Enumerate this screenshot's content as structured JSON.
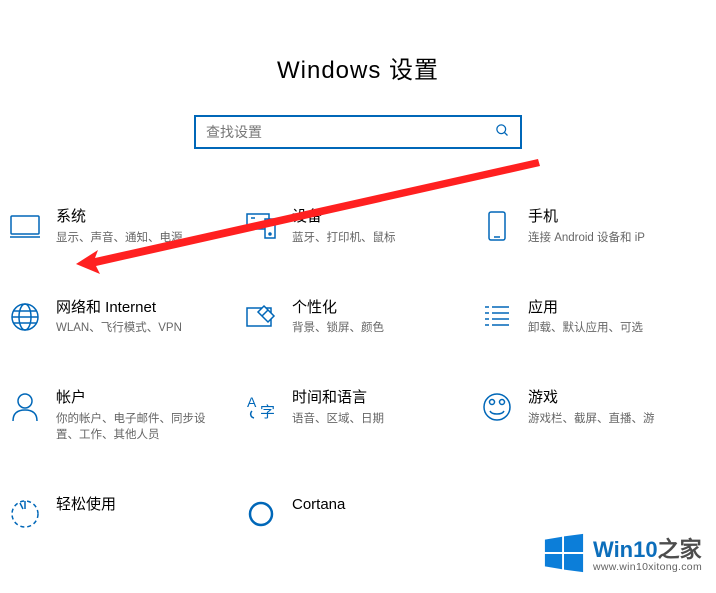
{
  "title": "Windows 设置",
  "search": {
    "placeholder": "查找设置"
  },
  "categories": [
    {
      "id": "system",
      "title": "系统",
      "desc": "显示、声音、通知、电源"
    },
    {
      "id": "devices",
      "title": "设备",
      "desc": "蓝牙、打印机、鼠标"
    },
    {
      "id": "phone",
      "title": "手机",
      "desc": "连接 Android 设备和 iP"
    },
    {
      "id": "network",
      "title": "网络和 Internet",
      "desc": "WLAN、飞行模式、VPN"
    },
    {
      "id": "personal",
      "title": "个性化",
      "desc": "背景、锁屏、颜色"
    },
    {
      "id": "apps",
      "title": "应用",
      "desc": "卸载、默认应用、可选"
    },
    {
      "id": "accounts",
      "title": "帐户",
      "desc": "你的帐户、电子邮件、同步设置、工作、其他人员"
    },
    {
      "id": "time",
      "title": "时间和语言",
      "desc": "语音、区域、日期"
    },
    {
      "id": "gaming",
      "title": "游戏",
      "desc": "游戏栏、截屏、直播、游"
    },
    {
      "id": "ease",
      "title": "轻松使用",
      "desc": ""
    },
    {
      "id": "cortana",
      "title": "Cortana",
      "desc": ""
    }
  ],
  "watermark": {
    "brand": "Win10",
    "suffix": "之家",
    "url": "www.win10xitong.com"
  }
}
